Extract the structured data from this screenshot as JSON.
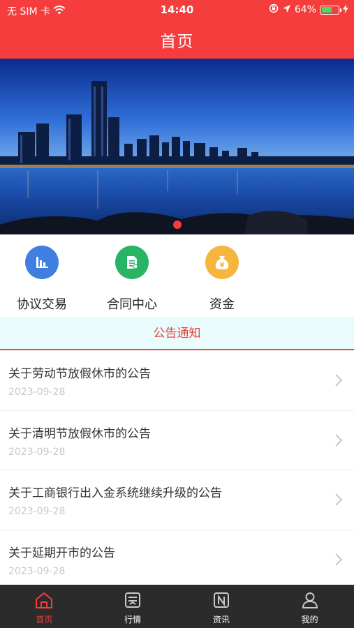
{
  "status_bar": {
    "carrier": "无 SIM 卡",
    "time": "14:40",
    "battery": "64%",
    "battery_level": 0.64
  },
  "header": {
    "title": "首页"
  },
  "banner": {
    "active_index": 0
  },
  "quick_actions": [
    {
      "label": "协议交易",
      "icon": "bar-chart-icon",
      "color": "#3f7fe0"
    },
    {
      "label": "合同中心",
      "icon": "document-icon",
      "color": "#27b565"
    },
    {
      "label": "资金",
      "icon": "money-bag-icon",
      "color": "#f6b53c"
    }
  ],
  "notice": {
    "heading": "公告通知",
    "items": [
      {
        "title": "关于劳动节放假休市的公告",
        "date": "2023-09-28"
      },
      {
        "title": "关于清明节放假休市的公告",
        "date": "2023-09-28"
      },
      {
        "title": "关于工商银行出入金系统继续升级的公告",
        "date": "2023-09-28"
      },
      {
        "title": "关于延期开市的公告",
        "date": "2023-09-28"
      }
    ]
  },
  "tabbar": {
    "active": "home",
    "items": [
      {
        "key": "home",
        "label": "首页",
        "icon": "home-icon"
      },
      {
        "key": "market",
        "label": "行情",
        "icon": "market-icon"
      },
      {
        "key": "news",
        "label": "资讯",
        "icon": "news-icon"
      },
      {
        "key": "mine",
        "label": "我的",
        "icon": "user-icon"
      }
    ]
  },
  "colors": {
    "primary": "#f53d3d",
    "notice_bg": "#e9fbfb",
    "tabbar_bg": "#2b2b2b"
  }
}
